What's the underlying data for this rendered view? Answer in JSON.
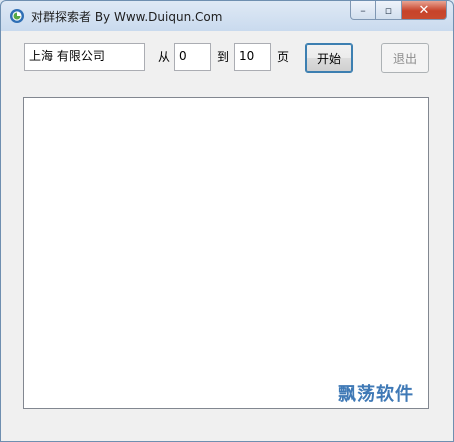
{
  "window": {
    "title": "对群探索者 By Www.Duiqun.Com",
    "caption": {
      "minimize": "–",
      "maximize": "▫",
      "close": "✕"
    }
  },
  "search": {
    "keyword_value": "上海 有限公司",
    "from_label": "从",
    "from_value": "0",
    "to_label": "到",
    "to_value": "10",
    "page_label": "页",
    "start_button": "开始",
    "exit_button": "退出"
  },
  "results": [],
  "watermark": "飘荡软件",
  "colors": {
    "accent": "#3f79b6",
    "titlebar": "#c9daee",
    "close": "#c7432a"
  },
  "icons": {
    "app": "app-logo-icon"
  }
}
